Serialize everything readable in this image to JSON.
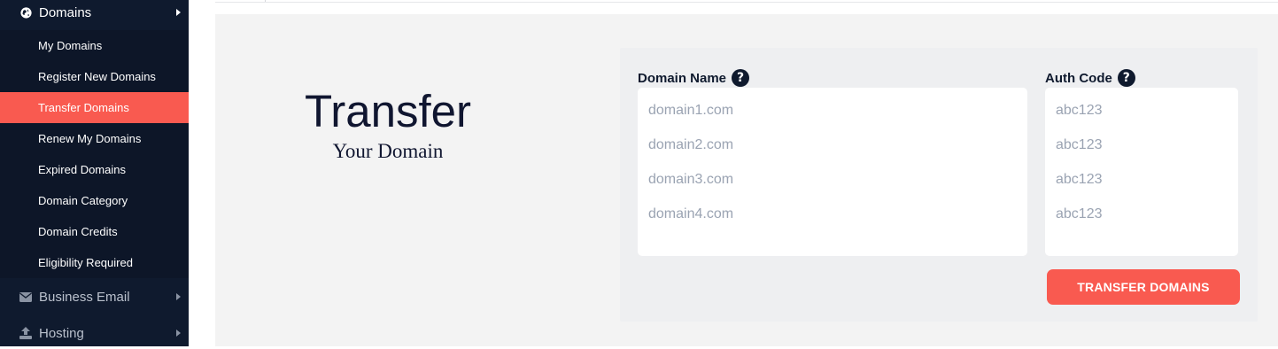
{
  "sidebar": {
    "domains_label": "Domains",
    "submenu": [
      {
        "label": "My Domains"
      },
      {
        "label": "Register New Domains"
      },
      {
        "label": "Transfer Domains",
        "active": true
      },
      {
        "label": "Renew My Domains"
      },
      {
        "label": "Expired Domains"
      },
      {
        "label": "Domain Category"
      },
      {
        "label": "Domain Credits"
      },
      {
        "label": "Eligibility Required"
      }
    ],
    "business_email_label": "Business Email",
    "hosting_label": "Hosting"
  },
  "hero": {
    "title": "Transfer",
    "subtitle": "Your Domain"
  },
  "form": {
    "domain_label": "Domain Name",
    "auth_label": "Auth Code",
    "help_glyph": "?",
    "domain_placeholder_lines": [
      "domain1.com",
      "domain2.com",
      "domain3.com",
      "domain4.com"
    ],
    "auth_placeholder_lines": [
      "abc123",
      "abc123",
      "abc123",
      "abc123"
    ],
    "submit_label": "TRANSFER DOMAINS"
  },
  "colors": {
    "sidebar_bg": "#0f1a2e",
    "accent": "#f95a50",
    "main_bg": "#f3f3f3",
    "placeholder": "#9aa3b2"
  },
  "icons": {
    "domains": "globe-icon",
    "business_email": "envelope-icon",
    "hosting": "upload-icon",
    "help": "question-circle-icon",
    "caret": "caret-right-icon"
  }
}
